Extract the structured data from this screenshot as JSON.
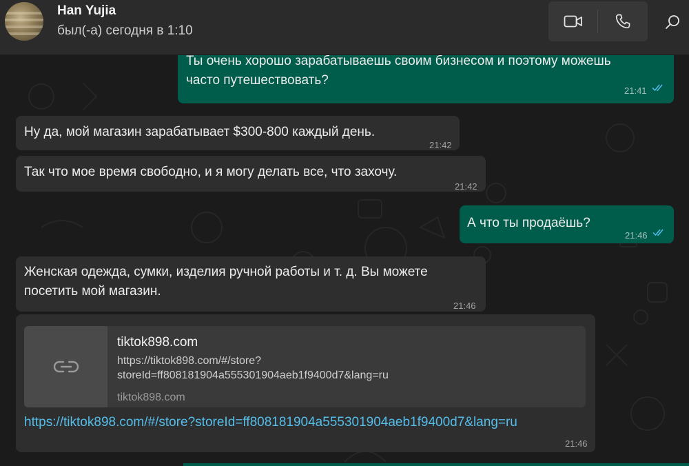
{
  "header": {
    "contact_name": "Han Yujia",
    "status": "был(-а) сегодня в 1:10",
    "icons": [
      "avatar",
      "video-call-icon",
      "voice-call-icon",
      "search-icon"
    ]
  },
  "messages": [
    {
      "direction": "out",
      "text": "Ты очень хорошо зарабатываешь своим бизнесом и поэтому можешь часто путешествовать?",
      "line1": "Ты очень хорошо зарабатываешь своим бизнесом и поэтому можешь",
      "line2": "часто путешествовать?",
      "time": "21:41",
      "status": "read"
    },
    {
      "direction": "in",
      "text": "Ну да, мой магазин зарабатывает $300-800 каждый день.",
      "time": "21:42"
    },
    {
      "direction": "in",
      "text": "Так что мое время свободно, и я могу делать все, что захочу.",
      "time": "21:42"
    },
    {
      "direction": "out",
      "text": "А что ты продаёшь?",
      "time": "21:46",
      "status": "read"
    },
    {
      "direction": "in",
      "text": "Женская одежда, сумки, изделия ручной работы и т. д. Вы можете посетить мой магазин.",
      "line1": "Женская одежда, сумки, изделия ручной работы и т. д. Вы можете",
      "line2": "посетить мой магазин.",
      "time": "21:46"
    },
    {
      "direction": "in",
      "time": "21:46",
      "link_preview": {
        "title": "tiktok898.com",
        "description_line1": "https://tiktok898.com/#/store?",
        "description_line2": "storeId=ff808181904a555301904aeb1f9400d7&lang=ru",
        "domain": "tiktok898.com"
      },
      "url": "https://tiktok898.com/#/store?storeId=ff808181904a555301904aeb1f9400d7&lang=ru"
    }
  ],
  "colors": {
    "header_bg": "#2b2b2b",
    "chat_bg": "#1b1b1b",
    "incoming_bubble": "#2e2e2e",
    "outgoing_bubble": "#005c4b",
    "link": "#53bdeb",
    "read_ticks": "#53bdeb"
  }
}
